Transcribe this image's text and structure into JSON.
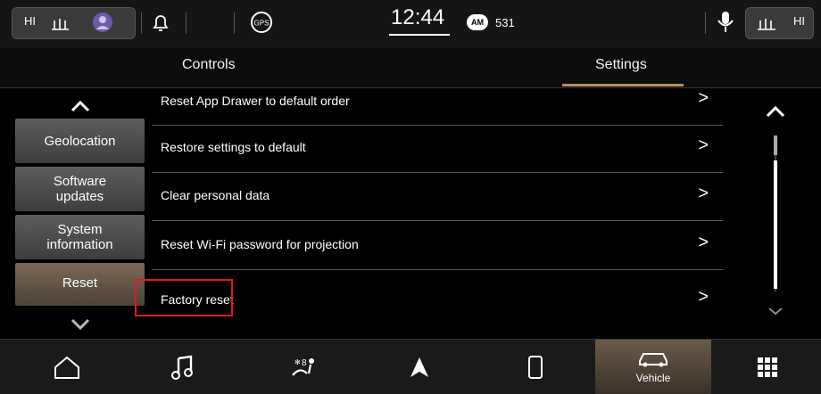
{
  "status_bar": {
    "left_heat_label": "HI",
    "clock": "12:44",
    "radio_band": "AM",
    "radio_station": "531",
    "right_heat_label": "HI",
    "gps_label": "GPS"
  },
  "tabs": [
    {
      "label": "Controls"
    },
    {
      "label": "Settings"
    }
  ],
  "sidebar": {
    "items": [
      {
        "label": "Geolocation"
      },
      {
        "label": "Software updates"
      },
      {
        "label": "System information"
      },
      {
        "label": "Reset"
      }
    ]
  },
  "settings_list": [
    {
      "label": "Reset App Drawer to default order"
    },
    {
      "label": "Restore settings to default"
    },
    {
      "label": "Clear personal data"
    },
    {
      "label": "Reset Wi-Fi password for projection"
    },
    {
      "label": "Factory reset"
    }
  ],
  "bottom_bar": {
    "vehicle_label": "Vehicle",
    "climate_temp": "8"
  },
  "colors": {
    "active_tab_underline": "#b98e5a",
    "highlight_box": "#e0191f",
    "active_dock_bg": "#5a4a3a"
  }
}
